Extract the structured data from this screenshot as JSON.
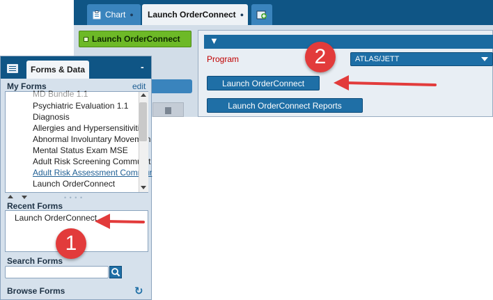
{
  "tabs": [
    {
      "label": "Chart"
    },
    {
      "label": "Launch OrderConnect"
    },
    {
      "icon": "add-tab-icon"
    }
  ],
  "left_nav": {
    "launch_label": "Launch OrderConnect"
  },
  "panel": {
    "program_label": "Program",
    "program_value": "ATLAS/JETT",
    "launch_button": "Launch OrderConnect",
    "reports_button": "Launch OrderConnect Reports"
  },
  "forms": {
    "tab_label": "Forms & Data",
    "minimize": "-",
    "my_forms_title": "My Forms",
    "edit_label": "edit",
    "my_forms": [
      "MD Bundle 1.1",
      "Psychiatric Evaluation 1.1",
      "Diagnosis",
      "Allergies and Hypersensitivities",
      "Abnormal Involuntary Movemen",
      "Mental Status Exam MSE",
      "Adult Risk Screening Communit",
      "Adult Risk Assessment Commur",
      "Launch OrderConnect"
    ],
    "recent_title": "Recent Forms",
    "recent_items": [
      "Launch OrderConnect"
    ],
    "search_title": "Search Forms",
    "search_value": "",
    "browse_title": "Browse Forms"
  },
  "callouts": [
    "1",
    "2"
  ],
  "colors": {
    "header_blue": "#0f5585",
    "button_blue": "#1f6fa6",
    "launch_green": "#6db927",
    "program_red": "#c00000",
    "annotation_red": "#e23b3b"
  }
}
